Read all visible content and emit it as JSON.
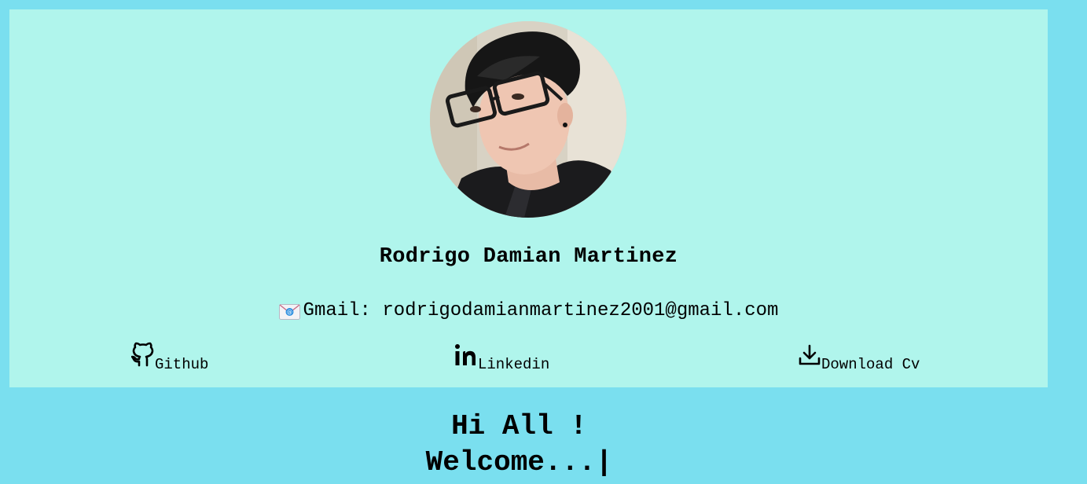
{
  "profile": {
    "name": "Rodrigo Damian Martinez",
    "avatar_icon": "profile-photo",
    "email_label": "Gmail: rodrigodamianmartinez2001@gmail.com",
    "email_icon": "envelope-icon"
  },
  "links": {
    "github": {
      "label": "Github",
      "icon": "github-icon"
    },
    "linkedin": {
      "label": "Linkedin",
      "icon": "linkedin-icon"
    },
    "cv": {
      "label": "Download Cv",
      "icon": "download-icon"
    }
  },
  "hero": {
    "line1": "Hi All !",
    "line2": "Welcome...|"
  },
  "colors": {
    "page_background": "#7adfef",
    "card_background": "#b0f5ec",
    "text": "#000000"
  }
}
